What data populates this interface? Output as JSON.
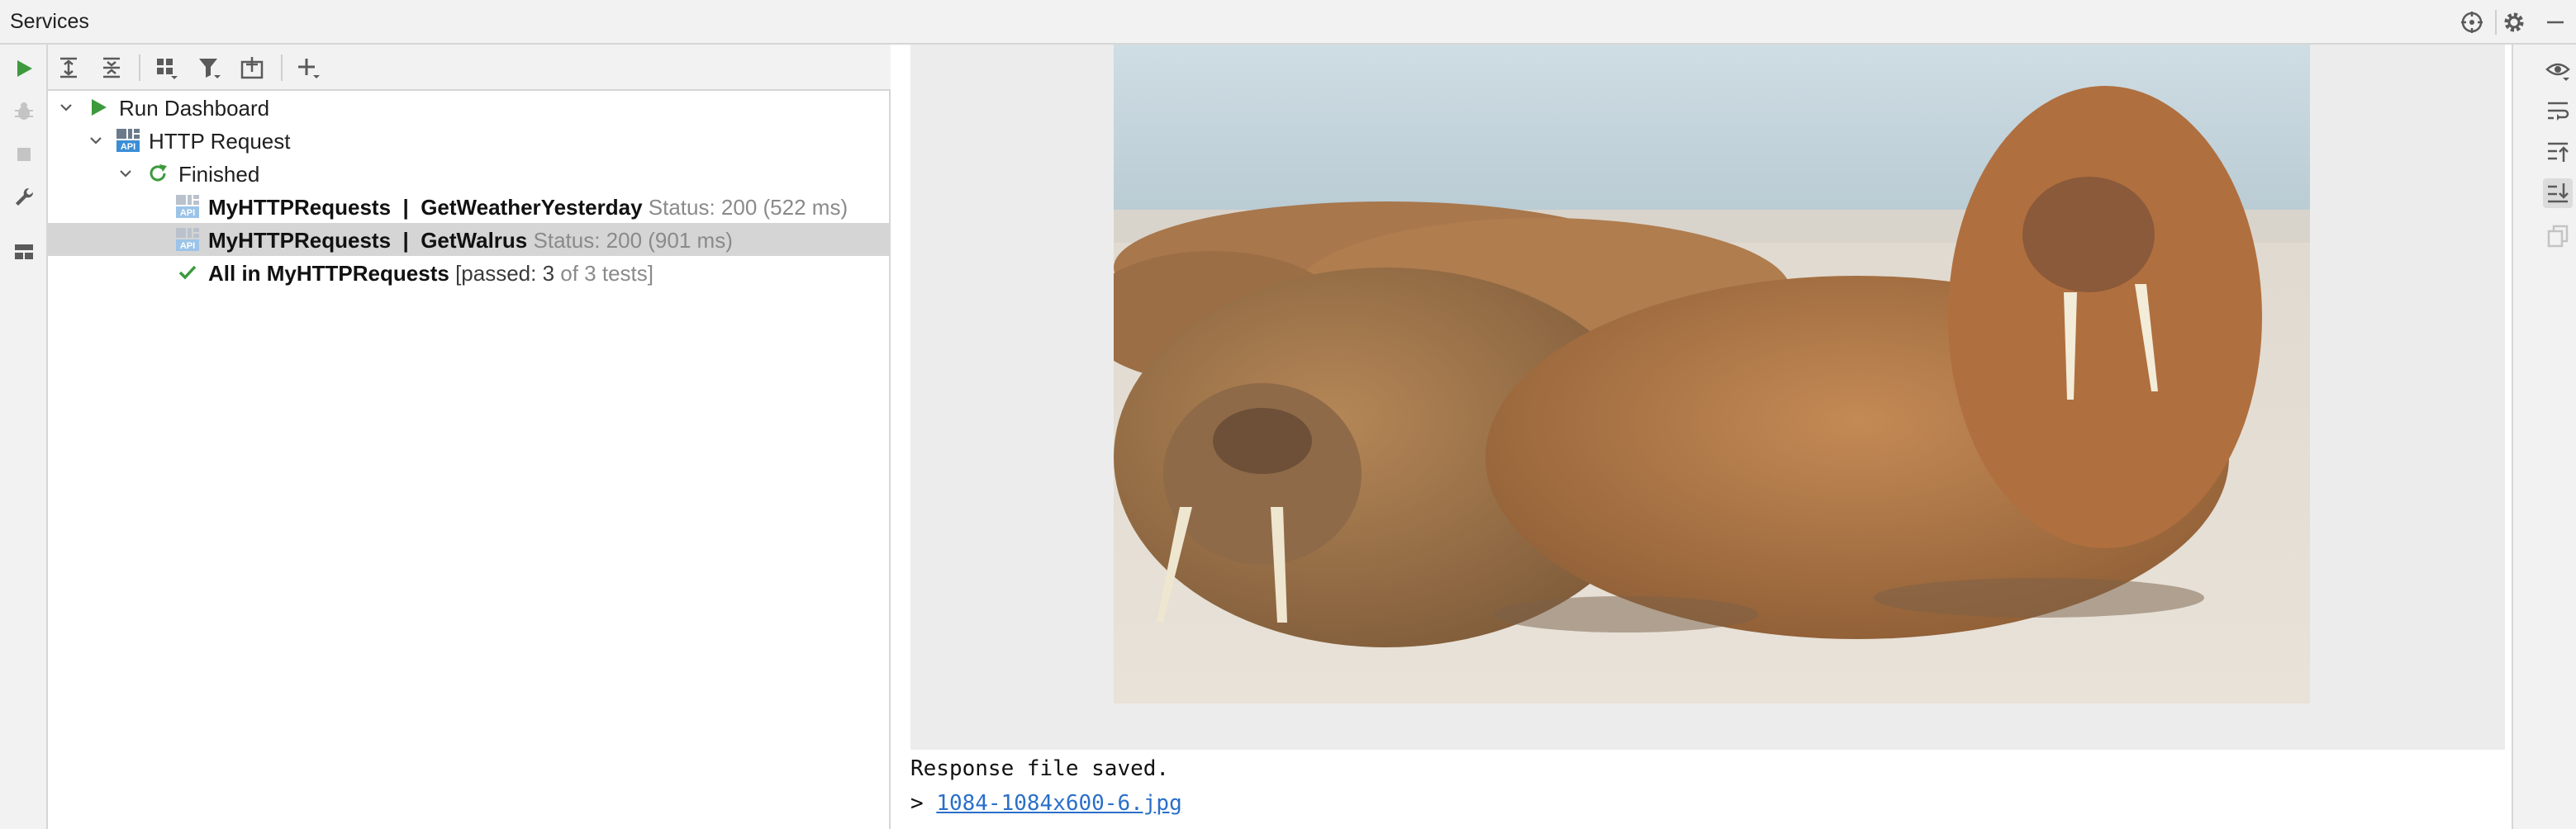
{
  "window": {
    "title": "Services"
  },
  "colors": {
    "run_green": "#3c9a3c",
    "link_blue": "#2a6fc9",
    "selection_gray": "#d5d5d5",
    "status_gray": "#8a8a8a"
  },
  "tree": {
    "root": {
      "label": "Run Dashboard",
      "icon": "run-icon"
    },
    "http": {
      "label": "HTTP Request",
      "icon": "api-icon"
    },
    "finished": {
      "label": "Finished",
      "icon": "rerun-icon"
    },
    "items": [
      {
        "name": "MyHTTPRequests  |  GetWeatherYesterday",
        "status": "Status: 200 (522 ms)",
        "icon": "api-request-icon",
        "selected": false
      },
      {
        "name": "MyHTTPRequests  |  GetWalrus",
        "status": "Status: 200 (901 ms)",
        "icon": "api-request-icon",
        "selected": true
      }
    ],
    "summary": {
      "name": "All in MyHTTPRequests",
      "prefix": "[passed: 3",
      "suffix": " of 3 tests]",
      "icon": "check-icon"
    }
  },
  "console": {
    "line1": "Response file saved.",
    "prompt": ">",
    "link": "1084-1084x600-6.jpg"
  }
}
